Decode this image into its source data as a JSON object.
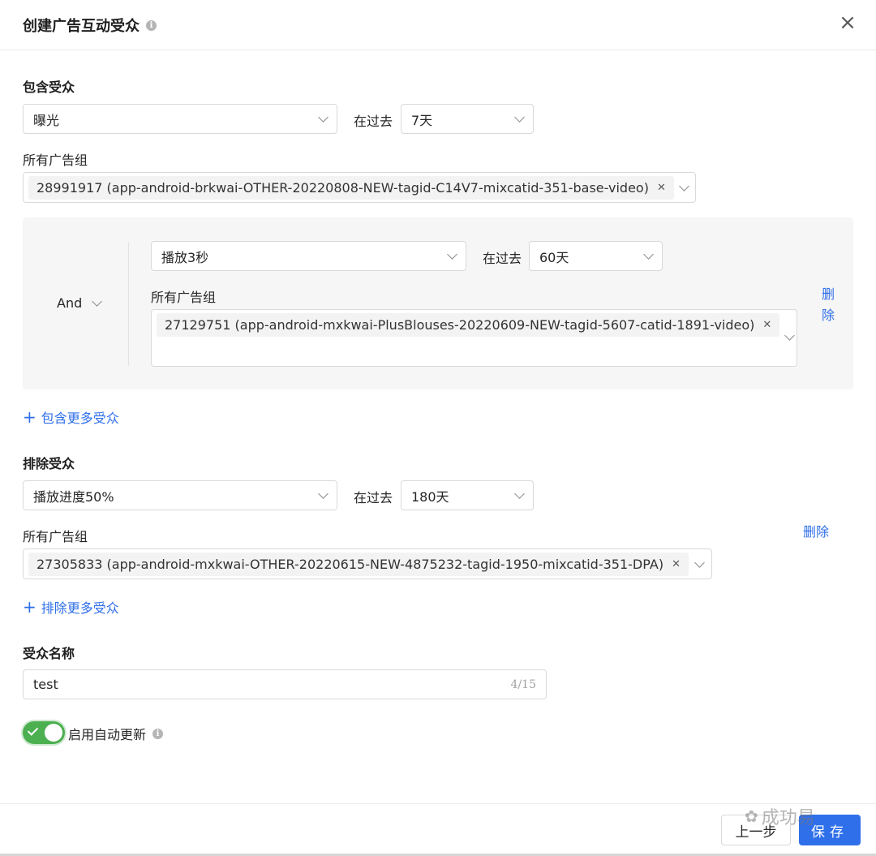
{
  "dialog": {
    "title": "创建广告互动受众",
    "close_label": "×"
  },
  "include": {
    "section_label": "包含受众",
    "rule1": {
      "event": "曝光",
      "past_label": "在过去",
      "period": "7天",
      "group_label": "所有广告组",
      "tag": "28991917 (app-android-brkwai-OTHER-20220808-NEW-tagid-C14V7-mixcatid-351-base-video)"
    },
    "rule2": {
      "logic": "And",
      "event": "播放3秒",
      "past_label": "在过去",
      "period": "60天",
      "group_label": "所有广告组",
      "tag": "27129751 (app-android-mxkwai-PlusBlouses-20220609-NEW-tagid-5607-catid-1891-video)",
      "delete_label_1": "删",
      "delete_label_2": "除"
    },
    "add_more": "包含更多受众"
  },
  "exclude": {
    "section_label": "排除受众",
    "event": "播放进度50%",
    "past_label": "在过去",
    "period": "180天",
    "group_label": "所有广告组",
    "delete_label": "删除",
    "tag": "27305833 (app-android-mxkwai-OTHER-20220615-NEW-4875232-tagid-1950-mixcatid-351-DPA)",
    "add_more": "排除更多受众"
  },
  "audience_name": {
    "label": "受众名称",
    "value": "test",
    "counter": "4/15"
  },
  "auto_update": {
    "label": "启用自动更新",
    "enabled": true
  },
  "footer": {
    "prev_label": "上一步",
    "save_label": "保存",
    "watermark": "成功易"
  },
  "icons": {
    "info": "info-icon",
    "close": "close-icon",
    "chevron": "chevron-down-icon",
    "plus": "plus-icon",
    "tag_remove": "tag-remove-icon",
    "check": "check-icon"
  },
  "colors": {
    "accent": "#2f6fea",
    "switch_on": "#4caf50",
    "panel_bg": "#f6f6f6"
  }
}
